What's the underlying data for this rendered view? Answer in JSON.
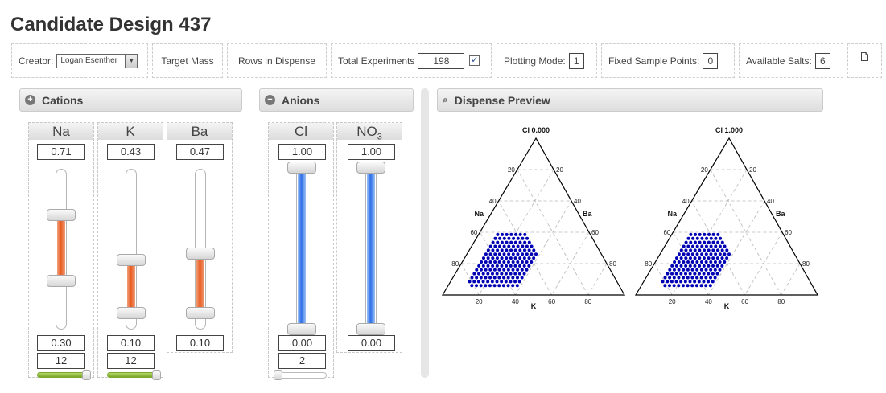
{
  "page": {
    "title": "Candidate Design 437"
  },
  "toolbar": {
    "creator_label": "Creator:",
    "creator_value": "Logan Esenther",
    "target_mass": "Target Mass",
    "rows_in_dispense": "Rows in Dispense",
    "total_experiments_label": "Total Experiments",
    "total_experiments_value": "198",
    "total_experiments_checked": true,
    "checkmark": "✓",
    "plotting_mode_label": "Plotting Mode:",
    "plotting_mode_value": "1",
    "fixed_sample_points_label": "Fixed Sample Points:",
    "fixed_sample_points_value": "0",
    "available_salts_label": "Available Salts:",
    "available_salts_value": "6",
    "document_icon": "document-icon"
  },
  "cations": {
    "header": "Cations",
    "header_icon": "+",
    "columns": [
      {
        "name": "Na",
        "top": "0.71",
        "bottom": "0.30",
        "steps": "12",
        "fill_color": "#e85a1e"
      },
      {
        "name": "K",
        "top": "0.43",
        "bottom": "0.10",
        "steps": "12",
        "fill_color": "#e85a1e"
      },
      {
        "name": "Ba",
        "top": "0.47",
        "bottom": "0.10",
        "fill_color": "#e85a1e"
      }
    ]
  },
  "anions": {
    "header": "Anions",
    "header_icon": "−",
    "columns": [
      {
        "name": "Cl",
        "top": "1.00",
        "bottom": "0.00",
        "steps": "2",
        "fill_color": "#2e6fe8"
      },
      {
        "name": "NO",
        "subscript": "3",
        "top": "1.00",
        "bottom": "0.00",
        "fill_color": "#2e6fe8"
      }
    ]
  },
  "preview": {
    "header": "Dispense Preview",
    "header_icon": "⌕",
    "plots": [
      {
        "title": "Cl 0.000",
        "left_label": "Na",
        "right_label": "Ba",
        "bottom_label": "K"
      },
      {
        "title": "Cl 1.000",
        "left_label": "Na",
        "right_label": "Ba",
        "bottom_label": "K"
      }
    ],
    "tick_labels": [
      "20",
      "40",
      "60",
      "80"
    ],
    "point_color": "#0000b4"
  }
}
